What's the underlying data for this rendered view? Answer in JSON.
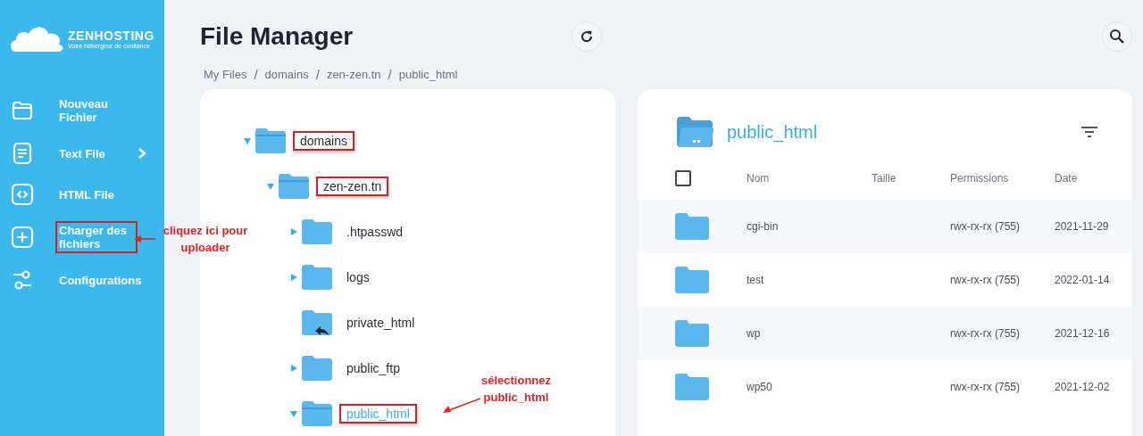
{
  "sidebar": {
    "logo": {
      "name": "ZENHOSTING",
      "tagline": "Votre hébergeur de confiance"
    },
    "items": [
      {
        "kind": "folder",
        "label": "Nouveau Fichier",
        "submenu": false,
        "highlighted": false
      },
      {
        "kind": "text",
        "label": "Text File",
        "submenu": true,
        "highlighted": false
      },
      {
        "kind": "html",
        "label": "HTML File",
        "submenu": false,
        "highlighted": false
      },
      {
        "kind": "upload",
        "label": "Charger des fichiers",
        "submenu": false,
        "highlighted": true
      },
      {
        "kind": "settings",
        "label": "Configurations",
        "submenu": false,
        "highlighted": false
      }
    ]
  },
  "header": {
    "title": "File Manager",
    "breadcrumb": [
      "My Files",
      "domains",
      "zen-zen.tn",
      "public_html"
    ],
    "separator": "/"
  },
  "tree": [
    {
      "name": "domains",
      "kind": "folder",
      "expanded": true,
      "selected": false,
      "highlighted": true,
      "children": [
        {
          "name": "zen-zen.tn",
          "kind": "folder",
          "expanded": true,
          "selected": false,
          "highlighted": true,
          "children": [
            {
              "name": ".htpasswd",
              "kind": "folder",
              "expanded": false,
              "selected": false,
              "highlighted": false
            },
            {
              "name": "logs",
              "kind": "folder",
              "expanded": false,
              "selected": false,
              "highlighted": false
            },
            {
              "name": "private_html",
              "kind": "symlink",
              "selected": false,
              "highlighted": false
            },
            {
              "name": "public_ftp",
              "kind": "folder",
              "expanded": false,
              "selected": false,
              "highlighted": false
            },
            {
              "name": "public_html",
              "kind": "folder",
              "expanded": true,
              "selected": true,
              "highlighted": true
            }
          ]
        }
      ]
    }
  ],
  "listing": {
    "title": "public_html",
    "select_all": {
      "checked": false
    },
    "columns": [
      "Nom",
      "Taille",
      "Permissions",
      "Date"
    ],
    "rows": [
      {
        "name": "cgi-bin",
        "permissions": "rwx-rx-rx (755)",
        "date": "2021-11-29"
      },
      {
        "name": "test",
        "permissions": "rwx-rx-rx (755)",
        "date": "2022-01-14"
      },
      {
        "name": "wp",
        "permissions": "rwx-rx-rx (755)",
        "date": "2021-12-16"
      },
      {
        "name": "wp50",
        "permissions": "rwx-rx-rx (755)",
        "date": "2021-12-02"
      }
    ]
  },
  "annotations": [
    {
      "text": "cliquez ici pour uploader"
    },
    {
      "text": "sélectionnez public_html"
    }
  ]
}
